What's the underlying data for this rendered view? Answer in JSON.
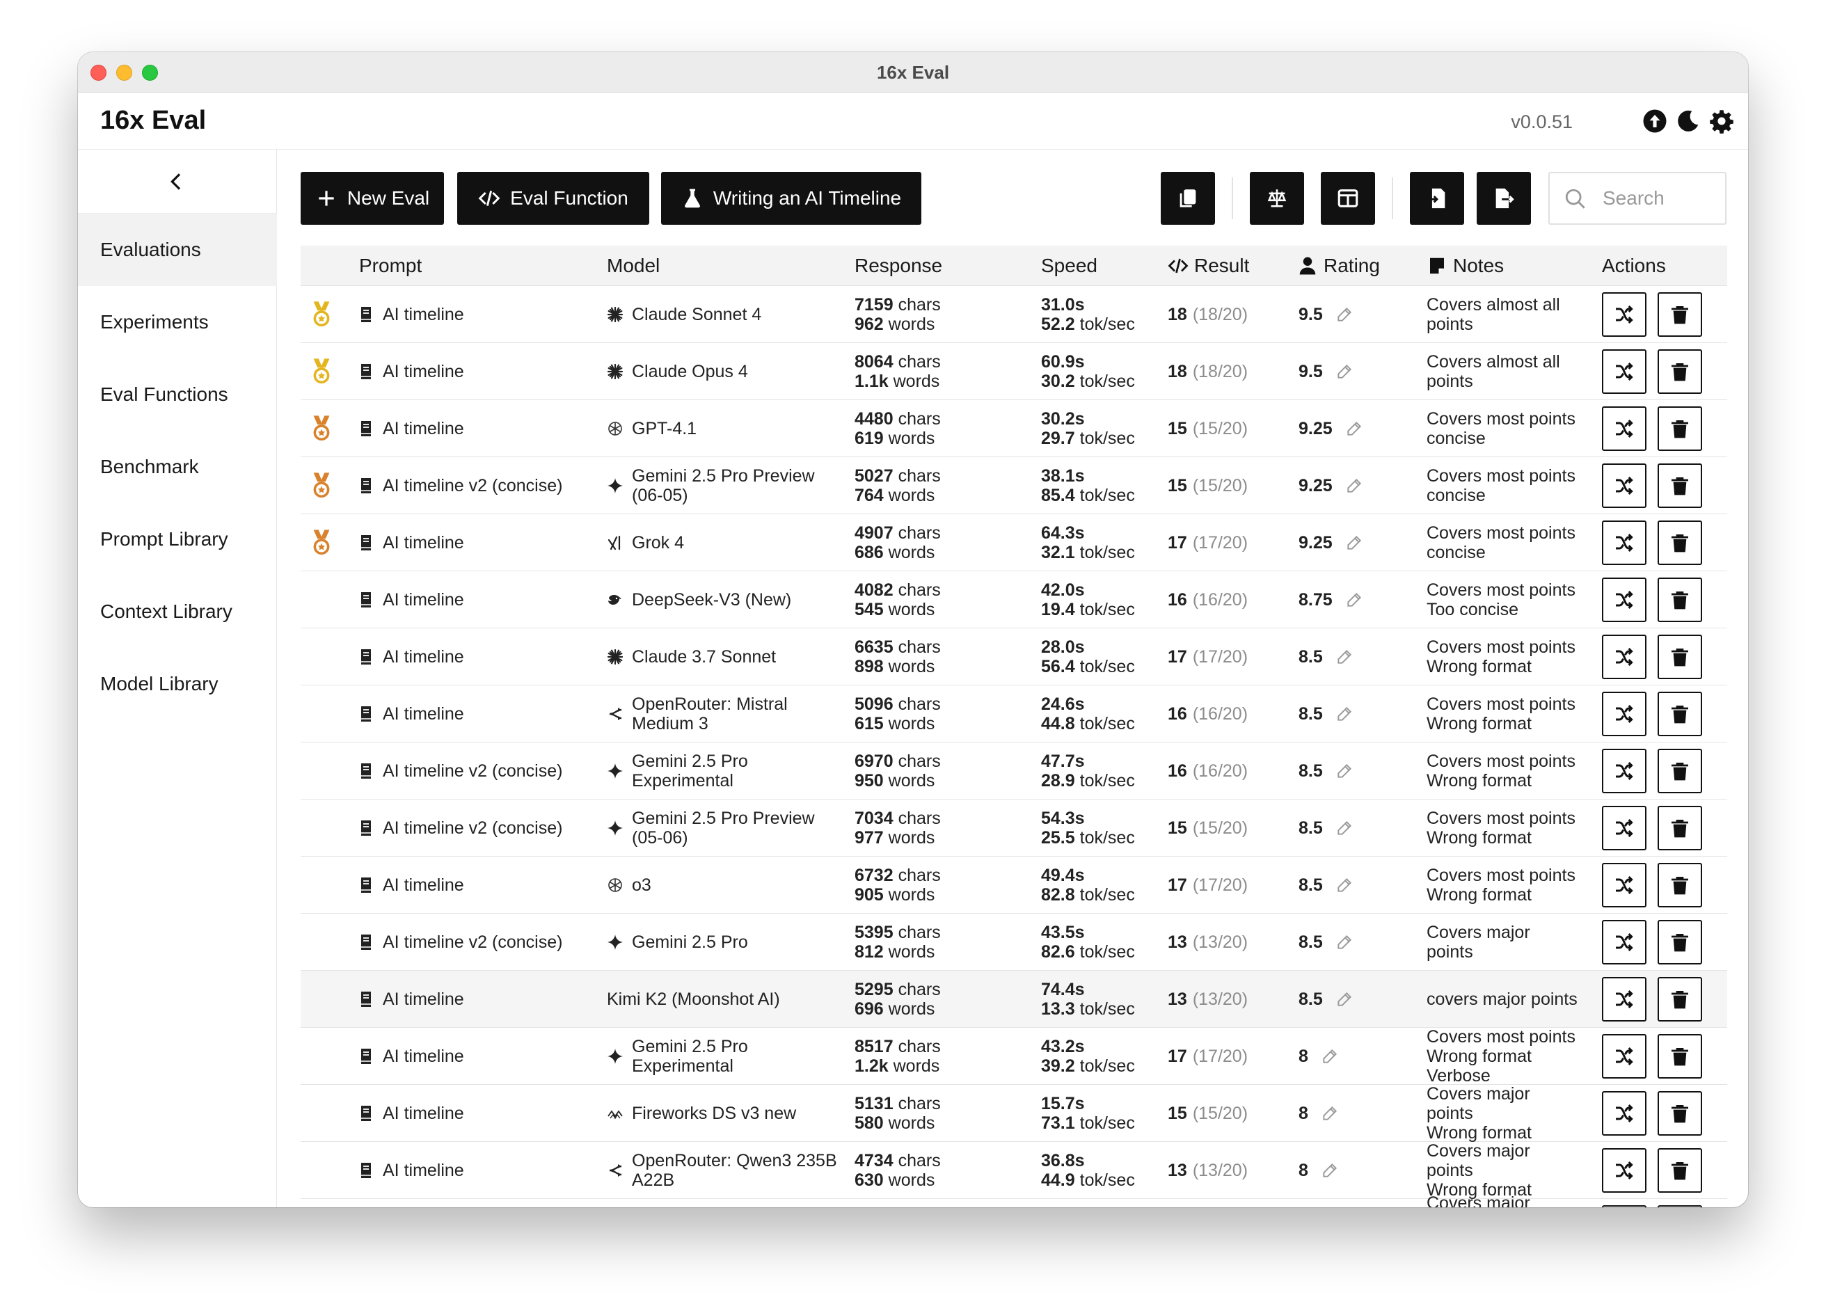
{
  "window": {
    "title": "16x Eval"
  },
  "header": {
    "app_title": "16x Eval",
    "version": "v0.0.51"
  },
  "sidebar": {
    "items": [
      {
        "label": "Evaluations",
        "active": true
      },
      {
        "label": "Experiments"
      },
      {
        "label": "Eval Functions"
      },
      {
        "label": "Benchmark"
      },
      {
        "label": "Prompt Library"
      },
      {
        "label": "Context Library"
      },
      {
        "label": "Model Library"
      }
    ]
  },
  "toolbar": {
    "new_eval": "New Eval",
    "eval_function": "Eval Function",
    "experiment": "Writing an AI Timeline",
    "search_placeholder": "Search"
  },
  "table": {
    "columns": {
      "prompt": "Prompt",
      "model": "Model",
      "response": "Response",
      "speed": "Speed",
      "result": "Result",
      "rating": "Rating",
      "notes": "Notes",
      "actions": "Actions"
    },
    "units": {
      "chars": "chars",
      "words": "words",
      "toksec": "tok/sec"
    },
    "rows": [
      {
        "medal": "gold",
        "prompt": "AI timeline",
        "model_icon": "anthropic",
        "model1": "Claude Sonnet 4",
        "model2": "",
        "chars": "7159",
        "words": "962",
        "time": "31.0s",
        "toks": "52.2",
        "result": "18",
        "result_sub": "(18/20)",
        "rating": "9.5",
        "notes1": "Covers almost all",
        "notes2": "points"
      },
      {
        "medal": "gold",
        "prompt": "AI timeline",
        "model_icon": "anthropic",
        "model1": "Claude Opus 4",
        "model2": "",
        "chars": "8064",
        "words": "1.1k",
        "time": "60.9s",
        "toks": "30.2",
        "result": "18",
        "result_sub": "(18/20)",
        "rating": "9.5",
        "notes1": "Covers almost all",
        "notes2": "points"
      },
      {
        "medal": "bronze",
        "prompt": "AI timeline",
        "model_icon": "openai",
        "model1": "GPT-4.1",
        "model2": "",
        "chars": "4480",
        "words": "619",
        "time": "30.2s",
        "toks": "29.7",
        "result": "15",
        "result_sub": "(15/20)",
        "rating": "9.25",
        "notes1": "Covers most points",
        "notes2": "concise"
      },
      {
        "medal": "bronze",
        "prompt": "AI timeline v2 (concise)",
        "model_icon": "gemini",
        "model1": "Gemini 2.5 Pro Preview",
        "model2": "(06-05)",
        "chars": "5027",
        "words": "764",
        "time": "38.1s",
        "toks": "85.4",
        "result": "15",
        "result_sub": "(15/20)",
        "rating": "9.25",
        "notes1": "Covers most points",
        "notes2": "concise"
      },
      {
        "medal": "bronze",
        "prompt": "AI timeline",
        "model_icon": "grok",
        "model1": "Grok 4",
        "model2": "",
        "chars": "4907",
        "words": "686",
        "time": "64.3s",
        "toks": "32.1",
        "result": "17",
        "result_sub": "(17/20)",
        "rating": "9.25",
        "notes1": "Covers most points",
        "notes2": "concise"
      },
      {
        "medal": "",
        "prompt": "AI timeline",
        "model_icon": "deepseek",
        "model1": "DeepSeek-V3 (New)",
        "model2": "",
        "chars": "4082",
        "words": "545",
        "time": "42.0s",
        "toks": "19.4",
        "result": "16",
        "result_sub": "(16/20)",
        "rating": "8.75",
        "notes1": "Covers most points",
        "notes2": "Too concise"
      },
      {
        "medal": "",
        "prompt": "AI timeline",
        "model_icon": "anthropic",
        "model1": "Claude 3.7 Sonnet",
        "model2": "",
        "chars": "6635",
        "words": "898",
        "time": "28.0s",
        "toks": "56.4",
        "result": "17",
        "result_sub": "(17/20)",
        "rating": "8.5",
        "notes1": "Covers most points",
        "notes2": "Wrong format"
      },
      {
        "medal": "",
        "prompt": "AI timeline",
        "model_icon": "openrouter",
        "model1": "OpenRouter: Mistral",
        "model2": "Medium 3",
        "chars": "5096",
        "words": "615",
        "time": "24.6s",
        "toks": "44.8",
        "result": "16",
        "result_sub": "(16/20)",
        "rating": "8.5",
        "notes1": "Covers most points",
        "notes2": "Wrong format"
      },
      {
        "medal": "",
        "prompt": "AI timeline v2 (concise)",
        "model_icon": "gemini",
        "model1": "Gemini 2.5 Pro",
        "model2": "Experimental",
        "chars": "6970",
        "words": "950",
        "time": "47.7s",
        "toks": "28.9",
        "result": "16",
        "result_sub": "(16/20)",
        "rating": "8.5",
        "notes1": "Covers most points",
        "notes2": "Wrong format"
      },
      {
        "medal": "",
        "prompt": "AI timeline v2 (concise)",
        "model_icon": "gemini",
        "model1": "Gemini 2.5 Pro Preview",
        "model2": "(05-06)",
        "chars": "7034",
        "words": "977",
        "time": "54.3s",
        "toks": "25.5",
        "result": "15",
        "result_sub": "(15/20)",
        "rating": "8.5",
        "notes1": "Covers most points",
        "notes2": "Wrong format"
      },
      {
        "medal": "",
        "prompt": "AI timeline",
        "model_icon": "openai",
        "model1": "o3",
        "model2": "",
        "chars": "6732",
        "words": "905",
        "time": "49.4s",
        "toks": "82.8",
        "result": "17",
        "result_sub": "(17/20)",
        "rating": "8.5",
        "notes1": "Covers most points",
        "notes2": "Wrong format"
      },
      {
        "medal": "",
        "prompt": "AI timeline v2 (concise)",
        "model_icon": "gemini",
        "model1": "Gemini 2.5 Pro",
        "model2": "",
        "chars": "5395",
        "words": "812",
        "time": "43.5s",
        "toks": "82.6",
        "result": "13",
        "result_sub": "(13/20)",
        "rating": "8.5",
        "notes1": "Covers major",
        "notes2": "points"
      },
      {
        "medal": "",
        "highlight": true,
        "prompt": "AI timeline",
        "model_icon": "",
        "model1": "Kimi K2 (Moonshot AI)",
        "model2": "",
        "chars": "5295",
        "words": "696",
        "time": "74.4s",
        "toks": "13.3",
        "result": "13",
        "result_sub": "(13/20)",
        "rating": "8.5",
        "notes1": "covers major points",
        "notes2": ""
      },
      {
        "medal": "",
        "prompt": "AI timeline",
        "model_icon": "gemini",
        "model1": "Gemini 2.5 Pro",
        "model2": "Experimental",
        "chars": "8517",
        "words": "1.2k",
        "time": "43.2s",
        "toks": "39.2",
        "result": "17",
        "result_sub": "(17/20)",
        "rating": "8",
        "notes1": "Covers most points",
        "notes2": "Wrong format",
        "notes3": "Verbose"
      },
      {
        "medal": "",
        "prompt": "AI timeline",
        "model_icon": "fireworks",
        "model1": "Fireworks DS v3 new",
        "model2": "",
        "chars": "5131",
        "words": "580",
        "time": "15.7s",
        "toks": "73.1",
        "result": "15",
        "result_sub": "(15/20)",
        "rating": "8",
        "notes1": "Covers major",
        "notes2": "points",
        "notes3": "Wrong format"
      },
      {
        "medal": "",
        "prompt": "AI timeline",
        "model_icon": "openrouter",
        "model1": "OpenRouter: Qwen3 235B",
        "model2": "A22B",
        "chars": "4734",
        "words": "630",
        "time": "36.8s",
        "toks": "44.9",
        "result": "13",
        "result_sub": "(13/20)",
        "rating": "8",
        "notes1": "Covers major",
        "notes2": "points",
        "notes3": "Wrong format"
      },
      {
        "medal": "",
        "prompt": "",
        "model_icon": "",
        "model1": "",
        "model2": "",
        "chars": "",
        "words": "",
        "time": "",
        "toks": "",
        "result": "",
        "result_sub": "",
        "rating": "",
        "notes1": "Covers major",
        "notes2": "",
        "partial": true
      }
    ]
  },
  "colors": {
    "gold": "#e3b51e",
    "bronze": "#d9822b",
    "dark": "#111111"
  }
}
